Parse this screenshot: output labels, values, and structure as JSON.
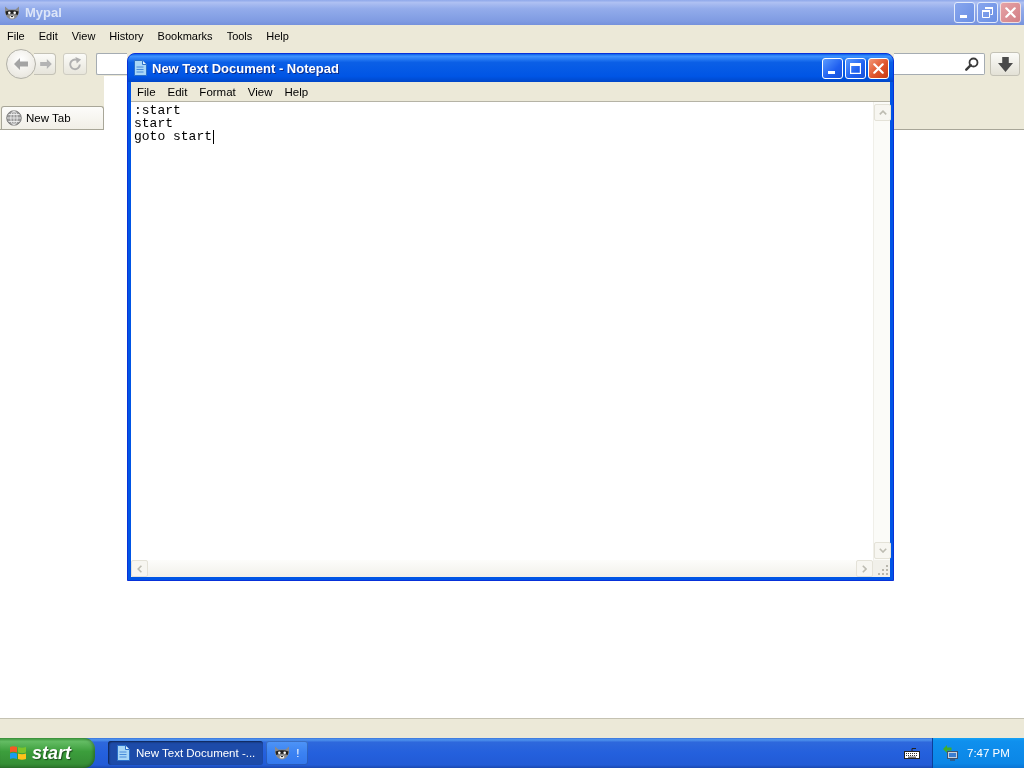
{
  "browser": {
    "title": "Mypal",
    "active": false,
    "maximized": true,
    "menu": [
      "File",
      "Edit",
      "View",
      "History",
      "Bookmarks",
      "Tools",
      "Help"
    ],
    "tabs": [
      {
        "label": "New Tab",
        "selected": true
      }
    ]
  },
  "notepad": {
    "title": "New Text Document - Notepad",
    "active": true,
    "maximized": false,
    "menu": [
      "File",
      "Edit",
      "Format",
      "View",
      "Help"
    ],
    "lines": [
      {
        "text": ":start",
        "cursor": false
      },
      {
        "text": "start",
        "cursor": false
      },
      {
        "text": "goto start",
        "cursor": true
      }
    ]
  },
  "taskbar": {
    "start_label": "start",
    "tasks": [
      {
        "label": "New Text Document -...",
        "kind": "notepad",
        "selected": true
      },
      {
        "label": "!",
        "kind": "browser",
        "selected": false
      }
    ],
    "clock": "7:47 PM"
  }
}
